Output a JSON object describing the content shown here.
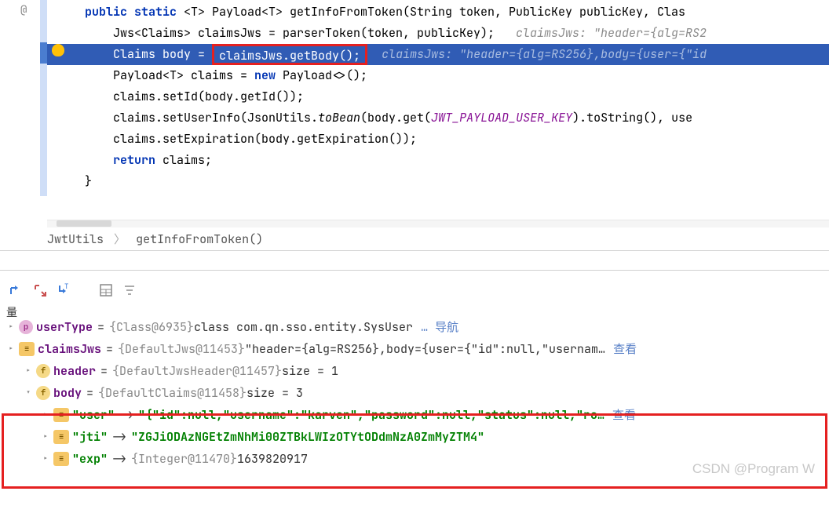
{
  "code": {
    "lines": [
      {
        "indent": 0,
        "tokens": [
          {
            "t": "public",
            "c": "kw"
          },
          {
            "t": " "
          },
          {
            "t": "static",
            "c": "kw"
          },
          {
            "t": " <T> Payload<T> getInfoFromToken(String token, PublicKey publicKey, Clas"
          }
        ]
      },
      {
        "indent": 1,
        "tokens": [
          {
            "t": "Jws<Claims> claimsJws = parserToken(token, publicKey);   "
          },
          {
            "t": "claimsJws: \"header={alg=RS2",
            "c": "comment-inline"
          }
        ]
      },
      {
        "indent": 1,
        "highlight": true,
        "tokens": [
          {
            "t": "Claims body = ",
            "c": "hl-white"
          },
          {
            "t": "claimsJws.getBody();",
            "c": "hl-white",
            "boxed": true
          },
          {
            "t": "  "
          },
          {
            "t": "claimsJws: \"header={alg=RS256},body={user={\"id",
            "c": "hl-comment"
          }
        ]
      },
      {
        "indent": 1,
        "tokens": [
          {
            "t": "Payload<T> claims = "
          },
          {
            "t": "new",
            "c": "new-kw"
          },
          {
            "t": " Payload<>();"
          }
        ]
      },
      {
        "indent": 1,
        "tokens": [
          {
            "t": "claims.setId(body.getId());"
          }
        ]
      },
      {
        "indent": 1,
        "tokens": [
          {
            "t": "claims.setUserInfo(JsonUtils."
          },
          {
            "t": "toBean",
            "c": "static-call"
          },
          {
            "t": "(body.get("
          },
          {
            "t": "JWT_PAYLOAD_USER_KEY",
            "c": "static-field"
          },
          {
            "t": ").toString(), use"
          }
        ]
      },
      {
        "indent": 1,
        "tokens": [
          {
            "t": "claims.setExpiration(body.getExpiration());"
          }
        ]
      },
      {
        "indent": 1,
        "tokens": [
          {
            "t": "return",
            "c": "kw"
          },
          {
            "t": " claims;"
          }
        ]
      },
      {
        "indent": 0,
        "tokens": [
          {
            "t": "}"
          }
        ]
      }
    ]
  },
  "breadcrumb": {
    "class": "JwtUtils",
    "method": "getInfoFromToken()"
  },
  "vars_header": "量",
  "debug_vars": [
    {
      "icon": "p",
      "expand": true,
      "name": "userType",
      "eq": "=",
      "obj": "{Class@6935}",
      "val": " class com.qn.sso.entity.SysUser",
      "extra": "… 导航",
      "topcut": true
    },
    {
      "icon": "stack",
      "expand": true,
      "name": "claimsJws",
      "eq": "=",
      "obj": "{DefaultJws@11453}",
      "val": " \"header={alg=RS256},body={user={\"id\":null,\"usernam…",
      "extra": " 查看"
    },
    {
      "icon": "f",
      "expand": true,
      "indent": 1,
      "name": "header",
      "eq": "=",
      "obj": "{DefaultJwsHeader@11457}",
      "val": "  size = 1"
    },
    {
      "icon": "f",
      "expand": "down",
      "indent": 1,
      "name": "body",
      "eq": "=",
      "obj": "{DefaultClaims@11458}",
      "val": "  size = 3"
    },
    {
      "icon": "stack",
      "expand": true,
      "indent": 2,
      "key": "\"user\"",
      "arrow": "->",
      "mapval": "\"{\"id\":null,\"username\":\"karven\",\"password\":null,\"status\":null,\"ro…",
      "extra": " 查看"
    },
    {
      "icon": "stack",
      "expand": true,
      "indent": 2,
      "key": "\"jti\"",
      "arrow": "->",
      "mapval": "\"ZGJiODAzNGEtZmNhMi00ZTBkLWIzOTYtODdmNzA0ZmMyZTM4\""
    },
    {
      "icon": "stack",
      "expand": true,
      "indent": 2,
      "key": "\"exp\"",
      "arrow": "->",
      "obj": "{Integer@11470}",
      "val": " 1639820917"
    }
  ],
  "watermark": "CSDN @Program W"
}
